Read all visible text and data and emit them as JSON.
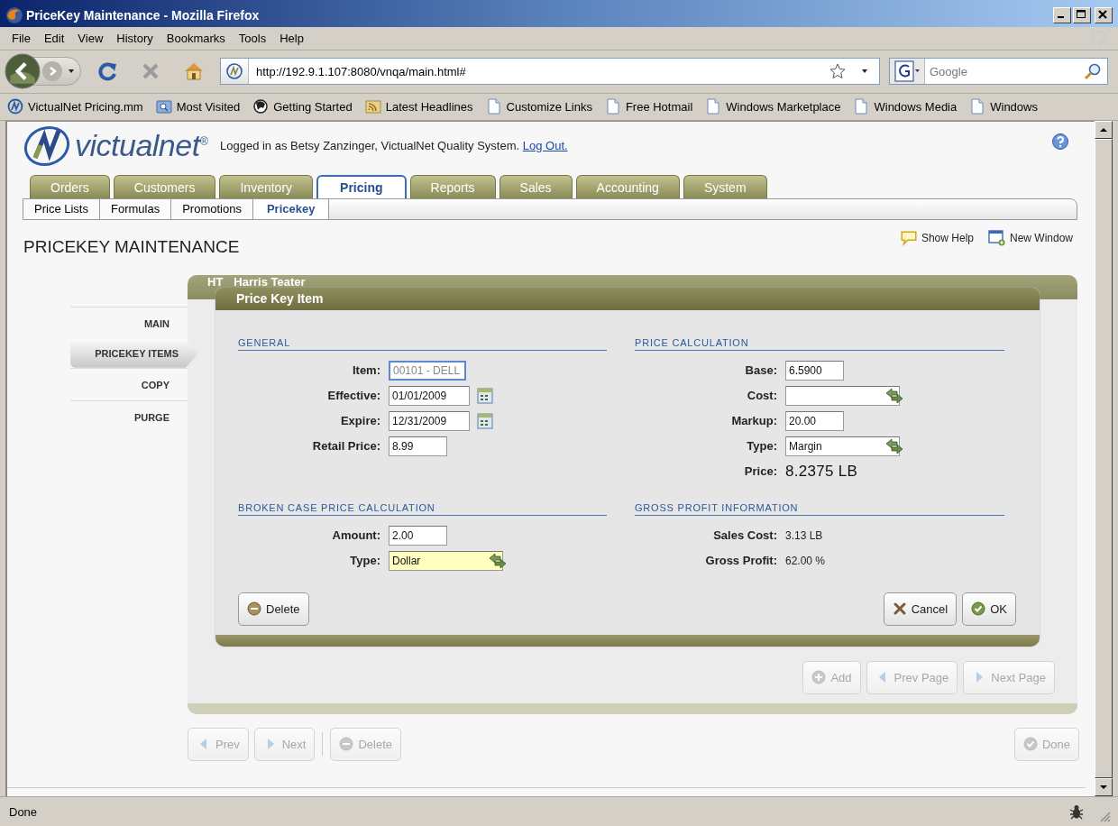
{
  "window": {
    "title": "PriceKey Maintenance - Mozilla Firefox"
  },
  "menu": [
    "File",
    "Edit",
    "View",
    "History",
    "Bookmarks",
    "Tools",
    "Help"
  ],
  "toolbar": {
    "url": "http://192.9.1.107:8080/vnqa/main.html#",
    "search_placeholder": "Google"
  },
  "bookmarks": [
    {
      "label": "VictualNet Pricing.mm",
      "kind": "site"
    },
    {
      "label": "Most Visited",
      "kind": "folder"
    },
    {
      "label": "Getting Started",
      "kind": "guide"
    },
    {
      "label": "Latest Headlines",
      "kind": "feed"
    },
    {
      "label": "Customize Links",
      "kind": "page"
    },
    {
      "label": "Free Hotmail",
      "kind": "page"
    },
    {
      "label": "Windows Marketplace",
      "kind": "page"
    },
    {
      "label": "Windows Media",
      "kind": "page"
    },
    {
      "label": "Windows",
      "kind": "page"
    }
  ],
  "header": {
    "logo": "victualnet$^{®}$",
    "session": "Logged in as Betsy Zanzinger, VictualNet Quality System.",
    "logout": "Log Out."
  },
  "tabs": [
    {
      "label": "Orders",
      "selected": false
    },
    {
      "label": "Customers",
      "selected": false
    },
    {
      "label": "Inventory",
      "selected": false
    },
    {
      "label": "Pricing",
      "selected": true
    },
    {
      "label": "Reports",
      "selected": false
    },
    {
      "label": "Sales",
      "selected": false
    },
    {
      "label": "Accounting",
      "selected": false
    },
    {
      "label": "System",
      "selected": false
    }
  ],
  "subtabs": [
    {
      "label": "Price Lists",
      "selected": false
    },
    {
      "label": "Formulas",
      "selected": false
    },
    {
      "label": "Promotions",
      "selected": false
    },
    {
      "label": "Pricekey",
      "selected": true
    }
  ],
  "title": "PRICEKEY MAINTENANCE",
  "page_links": [
    {
      "label": "Show Help",
      "kind": "help"
    },
    {
      "label": "New Window",
      "kind": "window"
    }
  ],
  "side_nav": [
    {
      "label": "MAIN",
      "selected": false
    },
    {
      "label": "PRICEKEY ITEMS",
      "selected": true
    },
    {
      "label": "COPY",
      "selected": false
    },
    {
      "label": "PURGE",
      "selected": false
    }
  ],
  "record": {
    "code": "HT",
    "name": "Harris Teater"
  },
  "dialog": {
    "title": "Price Key Item",
    "sections": [
      {
        "title": "GENERAL",
        "rows": [
          {
            "label": "Item:",
            "kind": "code",
            "value": "00101 - DELL",
            "disabled": true,
            "focused": false
          },
          {
            "label": "Effective:",
            "kind": "date",
            "value": "01/01/2009",
            "disabled": false,
            "focused": false
          },
          {
            "label": "Expire:",
            "kind": "date",
            "value": "12/31/2009",
            "disabled": false,
            "focused": false
          },
          {
            "label": "Retail Price:",
            "kind": "text",
            "value": "8.99",
            "disabled": false,
            "focused": false
          }
        ]
      },
      {
        "title": "PRICE CALCULATION",
        "rows": [
          {
            "label": "Base:",
            "kind": "text",
            "value": "6.5900",
            "disabled": false,
            "focused": false
          },
          {
            "label": "Cost:",
            "kind": "lookup",
            "disabled": false,
            "focused": false
          },
          {
            "label": "Markup:",
            "kind": "text",
            "value": "20.00",
            "disabled": false,
            "focused": false
          },
          {
            "label": "Type:",
            "kind": "lookup",
            "value": "Margin",
            "disabled": false,
            "focused": false
          },
          {
            "label": "Price:",
            "kind": "readout",
            "value": "8.2375 LB"
          }
        ]
      },
      {
        "title": "BROKEN CASE PRICE CALCULATION",
        "rows": [
          {
            "label": "Amount:",
            "kind": "text",
            "value": "2.00",
            "disabled": false,
            "focused": false
          },
          {
            "label": "Type:",
            "kind": "lookup",
            "value": "Dollar",
            "disabled": false,
            "focused": true
          }
        ]
      },
      {
        "title": "GROSS PROFIT INFORMATION",
        "rows": [
          {
            "label": "Sales Cost:",
            "kind": "info",
            "value": "3.13 LB"
          },
          {
            "label": "Gross Profit:",
            "kind": "info",
            "value": "62.00 %"
          }
        ]
      }
    ],
    "buttons": {
      "left": [
        {
          "label": "Delete",
          "kind": "delete",
          "disabled": false
        }
      ],
      "right": [
        {
          "label": "Cancel",
          "kind": "cancel",
          "disabled": false
        },
        {
          "label": "OK",
          "kind": "ok",
          "disabled": false
        }
      ]
    }
  },
  "panel_buttons": [
    {
      "label": "Add",
      "kind": "add",
      "disabled": true
    },
    {
      "label": "Prev Page",
      "kind": "prev",
      "disabled": true
    },
    {
      "label": "Next Page",
      "kind": "next",
      "disabled": true
    }
  ],
  "footer_buttons": {
    "left": [
      {
        "label": "Prev",
        "kind": "prev",
        "disabled": true
      },
      {
        "label": "Next",
        "kind": "next",
        "disabled": true
      }
    ],
    "middle": [
      {
        "label": "Delete",
        "kind": "delete",
        "disabled": true
      }
    ],
    "right": [
      {
        "label": "Done",
        "kind": "done",
        "disabled": true
      }
    ]
  },
  "status": "Done"
}
